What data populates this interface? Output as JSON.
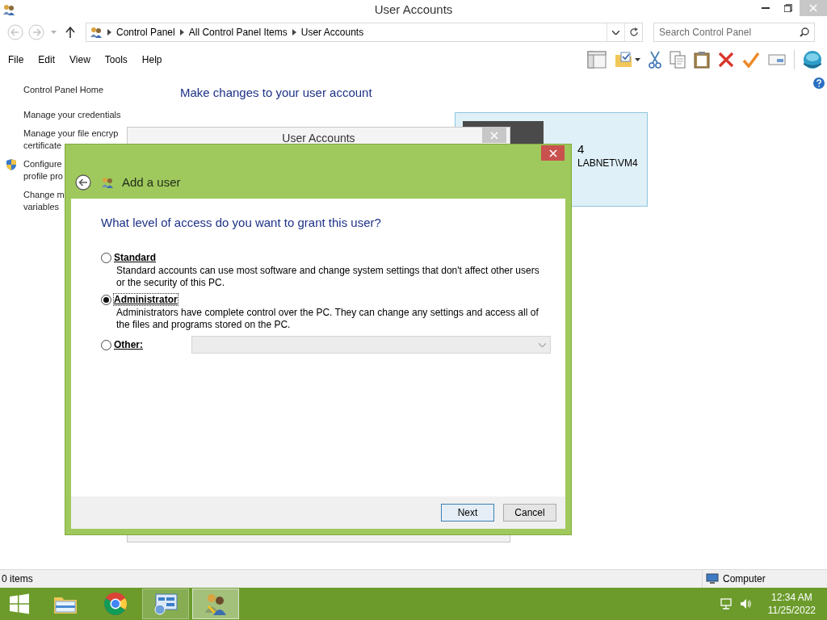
{
  "window": {
    "title": "User Accounts"
  },
  "address_bar": {
    "breadcrumbs": [
      "Control Panel",
      "All Control Panel Items",
      "User Accounts"
    ]
  },
  "search": {
    "placeholder": "Search Control Panel"
  },
  "menu": [
    "File",
    "Edit",
    "View",
    "Tools",
    "Help"
  ],
  "sidebar": {
    "items": [
      {
        "kind": "home",
        "lines": [
          "Control Panel Home"
        ]
      },
      {
        "kind": "link",
        "lines": [
          "Manage your credentials"
        ]
      },
      {
        "kind": "link",
        "lines": [
          "Manage your file encryp",
          "certificate"
        ]
      },
      {
        "kind": "admin",
        "lines": [
          "Configure",
          "profile pro"
        ]
      },
      {
        "kind": "link",
        "lines": [
          "Change m",
          "variables"
        ]
      }
    ]
  },
  "main": {
    "heading": "Make changes to your user account"
  },
  "account_card": {
    "name": "4",
    "domain": "LABNET\\VM4"
  },
  "background_window": {
    "title": "User Accounts"
  },
  "dialog": {
    "title": "Add a user",
    "question": "What level of access do you want to grant this user?",
    "options": [
      {
        "kind": "described",
        "label": "Standard",
        "description": "Standard accounts can use most software and change system settings that don't affect other users or the security of this PC.",
        "selected": false
      },
      {
        "kind": "described",
        "label": "Administrator",
        "description": "Administrators have complete control over the PC. They can change any settings and access all of the files and programs stored on the PC.",
        "selected": true
      },
      {
        "kind": "dropdown",
        "label": "Other:",
        "selected": false
      }
    ],
    "buttons": [
      {
        "label": "Next",
        "default": true
      },
      {
        "label": "Cancel",
        "default": false
      }
    ]
  },
  "status_bar": {
    "count": "0 items",
    "zone": "Computer"
  },
  "taskbar": {
    "apps": [
      {
        "kind": "explorer",
        "open": false,
        "selected": false
      },
      {
        "kind": "chrome",
        "open": false,
        "selected": false
      },
      {
        "kind": "control-panel",
        "open": true,
        "selected": false
      },
      {
        "kind": "user-accounts",
        "open": true,
        "selected": true
      }
    ],
    "time": "12:34 AM",
    "date": "11/25/2022"
  }
}
